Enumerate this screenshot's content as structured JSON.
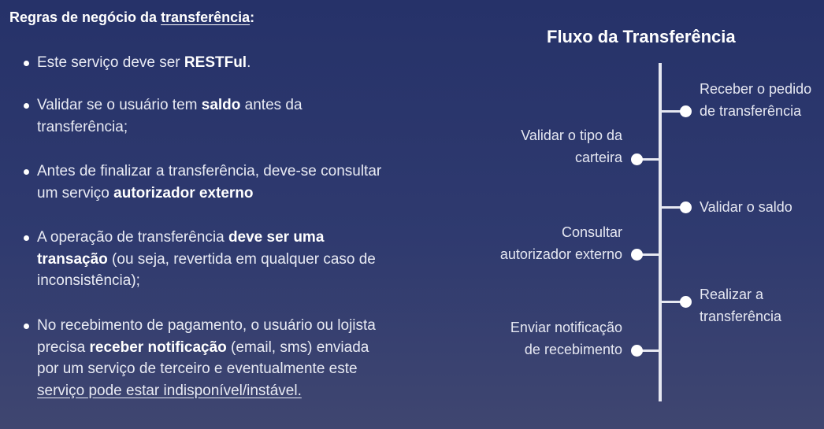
{
  "heading": {
    "prefix": "Regras de negócio da ",
    "underlined": "transferência",
    "suffix": ":"
  },
  "rules": [
    {
      "parts": [
        {
          "text": "Este serviço deve ser ",
          "bold": false
        },
        {
          "text": "RESTFul",
          "bold": true
        },
        {
          "text": ".",
          "bold": false
        }
      ]
    },
    {
      "parts": [
        {
          "text": "Validar se o usuário tem ",
          "bold": false
        },
        {
          "text": "saldo",
          "bold": true
        },
        {
          "text": " antes da transferência;",
          "bold": false
        }
      ]
    },
    {
      "parts": [
        {
          "text": "Antes de finalizar a transferência, deve-se consultar um serviço ",
          "bold": false
        },
        {
          "text": "autorizador externo",
          "bold": true
        }
      ]
    },
    {
      "parts": [
        {
          "text": "A operação de transferência ",
          "bold": false
        },
        {
          "text": "deve ser uma transação",
          "bold": true
        },
        {
          "text": " (ou seja, revertida em qualquer caso de inconsistência);",
          "bold": false
        }
      ]
    },
    {
      "parts": [
        {
          "text": "No recebimento de pagamento, o usuário ou lojista precisa ",
          "bold": false
        },
        {
          "text": "receber notificação",
          "bold": true
        },
        {
          "text": " (email, sms) enviada por um serviço de terceiro e eventualmente este ",
          "bold": false
        },
        {
          "text": "serviço pode estar indisponível/instável.",
          "bold": false,
          "underline": true
        }
      ]
    }
  ],
  "flow": {
    "title": "Fluxo da Transferência",
    "steps": [
      {
        "order": 1,
        "side": "right",
        "label": "Receber o pedido de transferência"
      },
      {
        "order": 2,
        "side": "left",
        "label": "Validar o tipo da carteira"
      },
      {
        "order": 3,
        "side": "right",
        "label": "Validar o saldo"
      },
      {
        "order": 4,
        "side": "left",
        "label": "Consultar autorizador externo"
      },
      {
        "order": 5,
        "side": "right",
        "label": "Realizar a transferência"
      },
      {
        "order": 6,
        "side": "left",
        "label": "Enviar notificação de recebimento"
      }
    ]
  }
}
